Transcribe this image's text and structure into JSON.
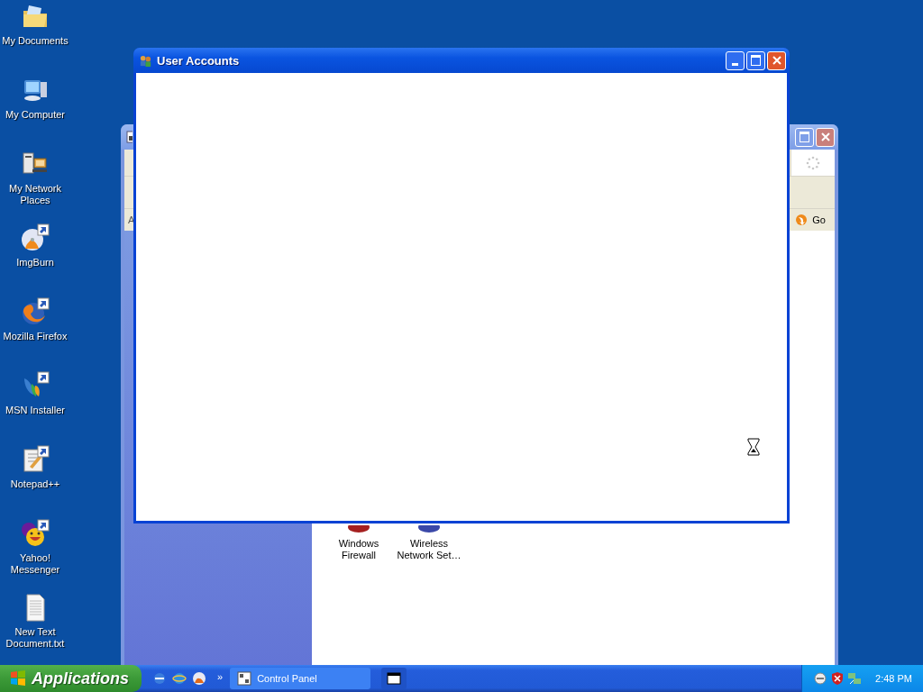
{
  "desktop_icons": [
    {
      "label": "My Documents"
    },
    {
      "label": "My Computer"
    },
    {
      "label": "My Network Places"
    },
    {
      "label": "ImgBurn"
    },
    {
      "label": "Mozilla Firefox"
    },
    {
      "label": "MSN Installer"
    },
    {
      "label": "Notepad++"
    },
    {
      "label": "Yahoo! Messenger"
    },
    {
      "label": "New Text Document.txt"
    }
  ],
  "background_window": {
    "address_label": "A",
    "go_button": "Go",
    "items": [
      {
        "label": "Windows Firewall"
      },
      {
        "label": "Wireless Network Set…"
      }
    ]
  },
  "front_window": {
    "title": "User Accounts"
  },
  "taskbar": {
    "start_button": "Applications",
    "quick_launch_more": "»",
    "tasks": [
      {
        "label": "Control Panel",
        "selected": false
      },
      {
        "selected": true
      }
    ],
    "clock": "2:48 PM"
  }
}
